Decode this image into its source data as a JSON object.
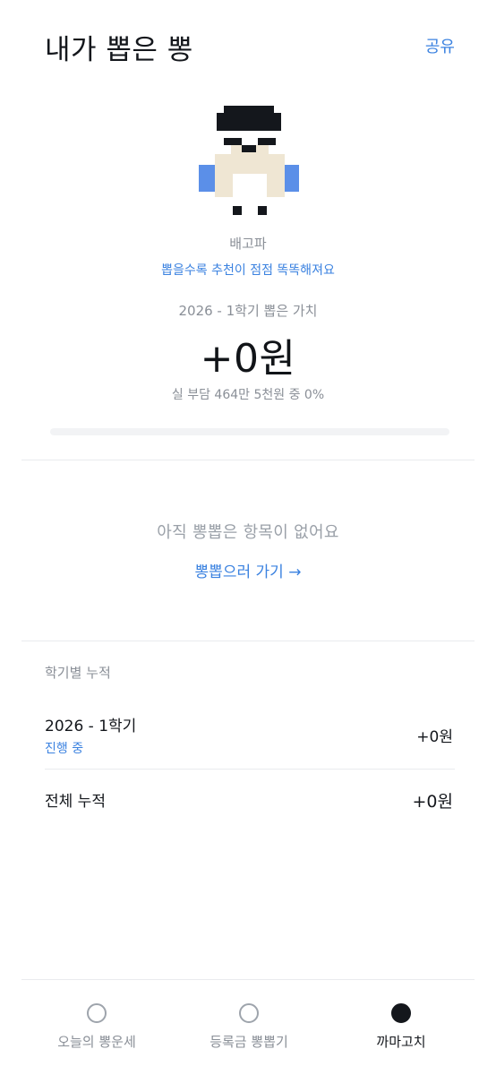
{
  "header": {
    "title": "내가 뽑은 뽕",
    "share_label": "공유"
  },
  "character": {
    "icon": "pixel-character-icon",
    "name": "배고파",
    "tip": "뽑을수록 추천이 점점 똑똑해져요"
  },
  "value": {
    "caption": "2026 - 1학기 뽑은 가치",
    "amount": "+0원",
    "sub": "실 부담 464만 5천원 중 0%",
    "progress_fraction": 0
  },
  "empty": {
    "text": "아직 뽕뽑은 항목이 없어요",
    "link": "뽕뽑으러 가기 →"
  },
  "semesters": {
    "title": "학기별 누적",
    "current": {
      "label": "2026 - 1학기",
      "status": "진행 중",
      "value": "+0원"
    },
    "total": {
      "label": "전체 누적",
      "value": "+0원"
    }
  },
  "nav": {
    "items": [
      {
        "label": "오늘의 뽕운세",
        "icon": "circle-outline-icon",
        "active": false
      },
      {
        "label": "등록금 뽕뽑기",
        "icon": "circle-outline-icon",
        "active": false
      },
      {
        "label": "까마고치",
        "icon": "circle-filled-icon",
        "active": true
      }
    ]
  },
  "colors": {
    "accent": "#3b82e0",
    "text": "#14171c",
    "muted": "#8a8f97",
    "character_skin": "#efe6d3",
    "character_arm": "#5b8fe8",
    "character_dark": "#14171c"
  }
}
